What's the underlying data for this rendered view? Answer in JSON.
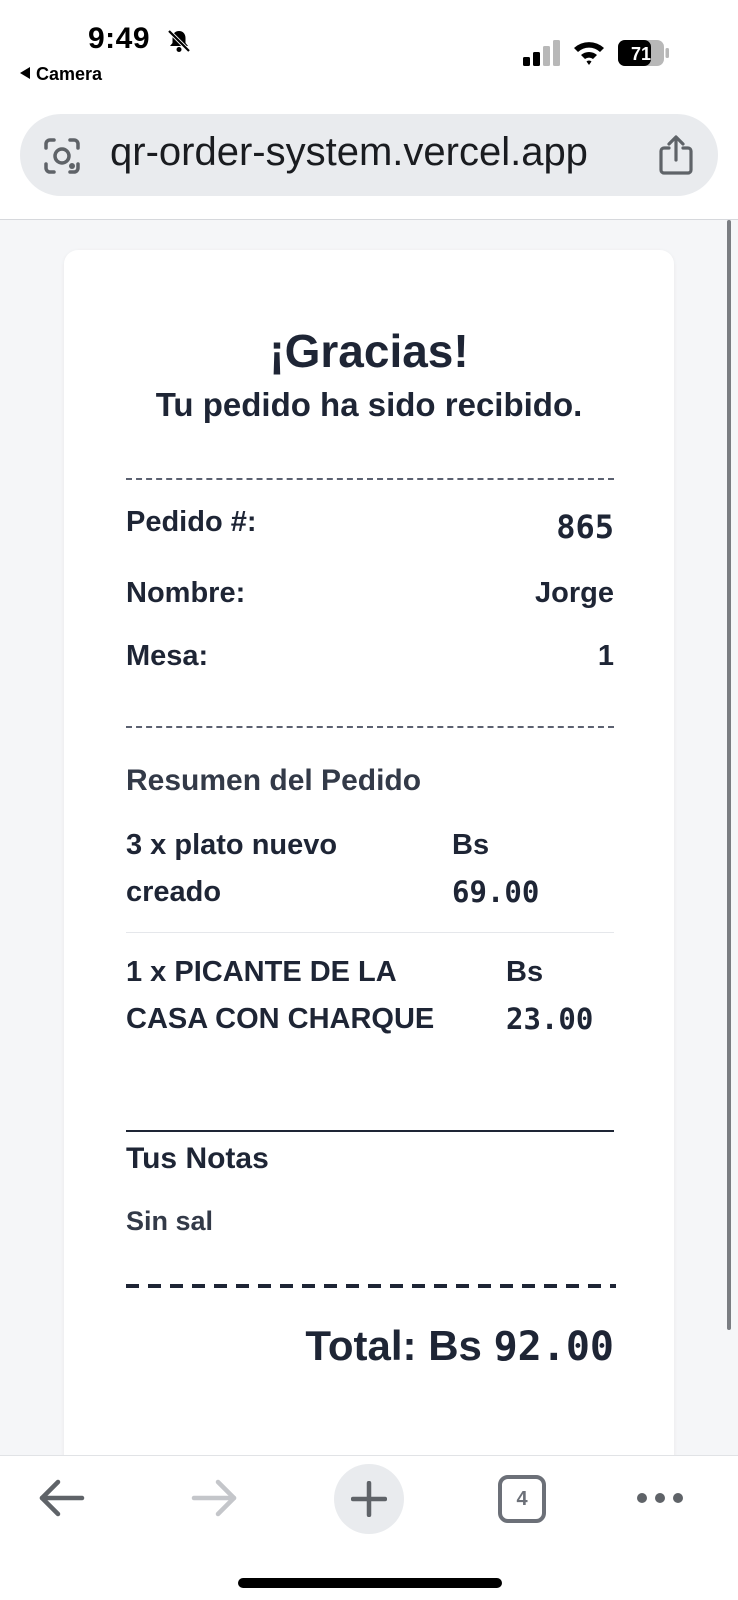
{
  "status_bar": {
    "time": "9:49",
    "back_app": "Camera",
    "battery": "71",
    "icons": [
      "bell-slash-icon",
      "signal-icon",
      "wifi-icon",
      "battery-icon"
    ]
  },
  "browser": {
    "url": "qr-order-system.vercel.app",
    "lens_icon": "camera-lens-icon",
    "share_icon": "share-icon",
    "tab_count": "4",
    "toolbar_icons": [
      "back-arrow-icon",
      "forward-arrow-icon",
      "plus-icon",
      "tabs-icon",
      "more-icon"
    ]
  },
  "receipt": {
    "title": "¡Gracias!",
    "subtitle": "Tu pedido ha sido recibido.",
    "order_label": "Pedido #:",
    "order_number": "865",
    "name_label": "Nombre:",
    "name_value": "Jorge",
    "table_label": "Mesa:",
    "table_value": "1",
    "summary_title": "Resumen del Pedido",
    "items": [
      {
        "line1": "3 x plato nuevo",
        "line2": "creado",
        "currency": "Bs",
        "price": "69.00"
      },
      {
        "line1": "1 x PICANTE DE LA",
        "line2": "CASA CON CHARQUE",
        "currency": "Bs",
        "price": "23.00"
      }
    ],
    "notes_title": "Tus Notas",
    "notes_text": "Sin sal",
    "total_label": "Total: Bs",
    "total_value": "92.00"
  },
  "colors": {
    "text": "#1e2535",
    "page_bg": "#f5f6f8",
    "url_bar_bg": "#e9ebee"
  }
}
